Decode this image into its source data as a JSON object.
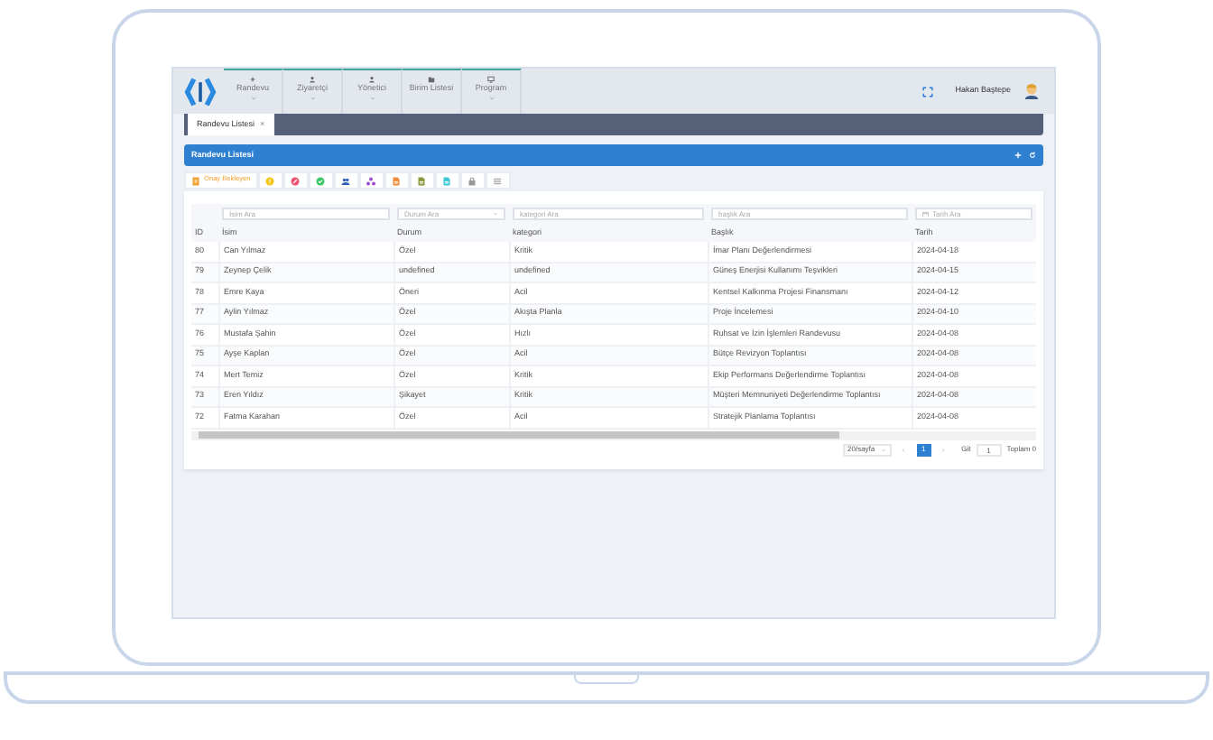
{
  "nav": {
    "menu": [
      {
        "label": "Randevu",
        "dropdown": true
      },
      {
        "label": "Ziyaretçi",
        "dropdown": true
      },
      {
        "label": "Yönetici",
        "dropdown": true
      },
      {
        "label": "Birim Listesi",
        "dropdown": false
      },
      {
        "label": "Program",
        "dropdown": true
      }
    ],
    "user": {
      "name": "Hakan Baştepe"
    }
  },
  "tabs": [
    {
      "label": "Randevu Listesi",
      "close": "×",
      "selected": true
    }
  ],
  "panel": {
    "title": "Randevu Listesi"
  },
  "toolbar": [
    {
      "kind": "pending",
      "label": "Onay Bekleyen",
      "color": "#f0a030"
    },
    {
      "kind": "warning",
      "color": "#f5c518"
    },
    {
      "kind": "cancel",
      "color": "#f0506e"
    },
    {
      "kind": "check",
      "color": "#3cc864"
    },
    {
      "kind": "users",
      "color": "#2f5fb8"
    },
    {
      "kind": "network",
      "color": "#9b4dca"
    },
    {
      "kind": "document",
      "color": "#f08c3c"
    },
    {
      "kind": "document",
      "color": "#8a9a3c"
    },
    {
      "kind": "document",
      "color": "#3cc8d8"
    },
    {
      "kind": "lock",
      "color": "#9a9a9a"
    },
    {
      "kind": "list",
      "color": "#b0b0b0"
    }
  ],
  "table": {
    "filters": [
      {
        "kind": "text",
        "placeholder": "İsim Ara"
      },
      {
        "kind": "select",
        "placeholder": "Durum Ara"
      },
      {
        "kind": "text",
        "placeholder": "kategori Ara"
      },
      {
        "kind": "text",
        "placeholder": "başlık Ara"
      },
      {
        "kind": "date",
        "placeholder": "Tarih Ara"
      }
    ],
    "columns": [
      "ID",
      "İsim",
      "Durum",
      "kategori",
      "Başlık",
      "Tarih"
    ],
    "rows": [
      [
        "80",
        "Can Yılmaz",
        "Özel",
        "Kritik",
        "İmar Planı Değerlendirmesi",
        "2024-04-18"
      ],
      [
        "79",
        "Zeynep Çelik",
        "undefined",
        "undefined",
        "Güneş Enerjisi Kullanımı Teşvikleri",
        "2024-04-15"
      ],
      [
        "78",
        "Emre Kaya",
        "Öneri",
        "Acil",
        "Kentsel Kalkınma Projesi Finansmanı",
        "2024-04-12"
      ],
      [
        "77",
        "Aylin Yılmaz",
        "Özel",
        "Akışta Planla",
        "Proje İncelemesi",
        "2024-04-10"
      ],
      [
        "76",
        "Mustafa Şahin",
        "Özel",
        "Hızlı",
        "Ruhsat ve İzin İşlemleri Randevusu",
        "2024-04-08"
      ],
      [
        "75",
        "Ayşe Kaplan",
        "Özel",
        "Acil",
        "Bütçe Revizyon Toplantısı",
        "2024-04-08"
      ],
      [
        "74",
        "Mert Temiz",
        "Özel",
        "Kritik",
        "Ekip Performans Değerlendirme Toplantısı",
        "2024-04-08"
      ],
      [
        "73",
        "Eren Yıldız",
        "Şikayet",
        "Kritik",
        "Müşteri Memnuniyeti Değerlendirme Toplantısı",
        "2024-04-08"
      ],
      [
        "72",
        "Fatma Karahan",
        "Özel",
        "Acil",
        "Stratejik Planlama Toplantısı",
        "2024-04-08"
      ]
    ]
  },
  "pagination": {
    "page_size": "20/sayfa",
    "pages": [
      {
        "label": "1",
        "selected": true
      }
    ],
    "goto_label": "Git",
    "goto_value": "1",
    "total": "Toplam 0"
  }
}
